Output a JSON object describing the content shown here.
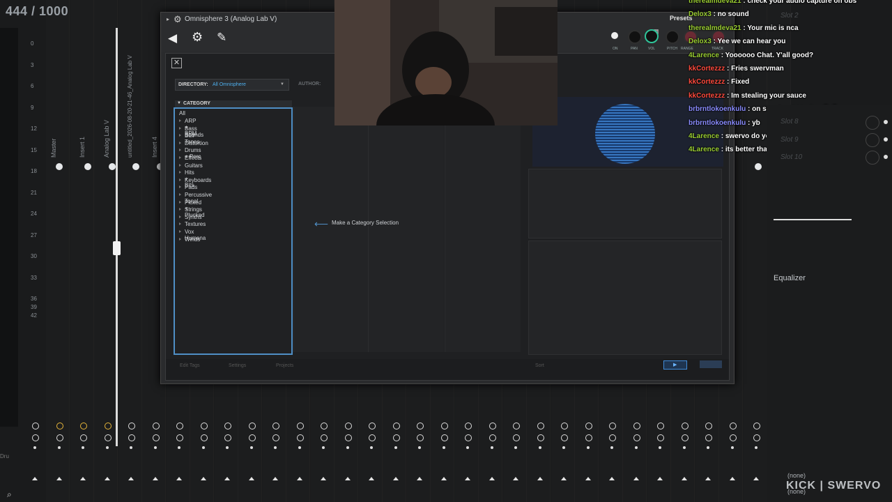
{
  "counter": "444 / 1000",
  "mixer": {
    "db_ticks": [
      "0",
      "3",
      "6",
      "9",
      "12",
      "15",
      "18",
      "21",
      "24",
      "27",
      "30",
      "33",
      "36",
      "39",
      "42"
    ],
    "strips": [
      "Master",
      "Insert 1",
      "Analog Lab V",
      "untitled_2026-08-20-21-46_Analog Lab V",
      "Insert 4"
    ],
    "left_label": "Dru"
  },
  "omni": {
    "title": "Omnisphere 3 (Analog Lab V)",
    "close": "✕",
    "directory_label": "DIRECTORY:",
    "directory_value": "All Omnisphere",
    "author_label": "AUTHOR:",
    "category_header": "CATEGORY",
    "category_all": "All",
    "categories": [
      "ARP + BPM",
      "Bass Sounds",
      "Bell Tones",
      "Distortion",
      "Drums + Perc",
      "Effects",
      "Guitars",
      "Hits + Bits",
      "Keyboards",
      "Pads",
      "Percussive Tonal",
      "Picked + Plucked",
      "Strings",
      "Synths",
      "Textures",
      "Vox Humana",
      "Winds"
    ],
    "make_selection": "Make a Category Selection",
    "bottom": [
      "Edit Tags",
      "Settings",
      "Projects",
      "Sort"
    ],
    "knob_labels": [
      "ON",
      "PAN",
      "VOL",
      "PITCH",
      "RANGE",
      "TRACK"
    ]
  },
  "presets_label": "Presets",
  "chat": [
    {
      "user": "therealmdeva21",
      "color": "#9acd32",
      "msg": "check your audio capture on obs"
    },
    {
      "user": "Delox3",
      "color": "#9acd32",
      "msg": "no sound"
    },
    {
      "user": "therealmdeva21",
      "color": "#9acd32",
      "msg": "Your mic is nca"
    },
    {
      "user": "Delox3",
      "color": "#9acd32",
      "msg": "Yee we can hear you"
    },
    {
      "user": "4Larence",
      "color": "#9acd32",
      "msg": "Yoooooo Chat. Y'all good?"
    },
    {
      "user": "kkCortezzz",
      "color": "#ff4a3d",
      "msg": "Fries swervman"
    },
    {
      "user": "kkCortezzz",
      "color": "#ff4a3d",
      "msg": "Fixed"
    },
    {
      "user": "kkCortezzz",
      "color": "#ff4a3d",
      "msg": "Im stealing your sauce"
    },
    {
      "user": "brbrntlokoenkulu",
      "color": "#8a8cff",
      "msg": "on sum by shi hollon😂😂"
    },
    {
      "user": "brbrntlokoenkulu",
      "color": "#8a8cff",
      "msg": "yb"
    },
    {
      "user": "4Larence",
      "color": "#9acd32",
      "msg": "swervo do you have shaperbox?"
    },
    {
      "user": "4Larence",
      "color": "#9acd32",
      "msg": "its better than half time ngl"
    }
  ],
  "right_panel": {
    "slots": [
      "Slot 2",
      "Slot 8",
      "Slot 9",
      "Slot 10"
    ],
    "equalizer": "Equalizer",
    "none1": "(none)",
    "none2": "(none)"
  },
  "watermark": "KICK | SWERVO"
}
